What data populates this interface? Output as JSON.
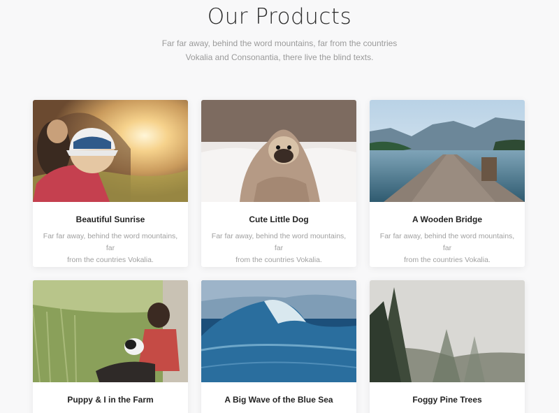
{
  "header": {
    "title": "Our Products",
    "subtitle_line1": "Far far away, behind the word mountains, far from the countries",
    "subtitle_line2": "Vokalia and Consonantia, there live the blind texts."
  },
  "products": [
    {
      "title": "Beautiful Sunrise",
      "desc_line1": "Far far away, behind the word mountains, far",
      "desc_line2": "from the countries Vokalia.",
      "image": "couple-watching-sunrise"
    },
    {
      "title": "Cute Little Dog",
      "desc_line1": "Far far away, behind the word mountains, far",
      "desc_line2": "from the countries Vokalia.",
      "image": "pug-in-blanket"
    },
    {
      "title": "A Wooden Bridge",
      "desc_line1": "Far far away, behind the word mountains, far",
      "desc_line2": "from the countries Vokalia.",
      "image": "wooden-pier-lake"
    },
    {
      "title": "Puppy & I in the Farm",
      "image": "man-with-puppy-in-grass"
    },
    {
      "title": "A Big Wave of the Blue Sea",
      "image": "ocean-wave"
    },
    {
      "title": "Foggy Pine Trees",
      "image": "foggy-forest"
    }
  ]
}
